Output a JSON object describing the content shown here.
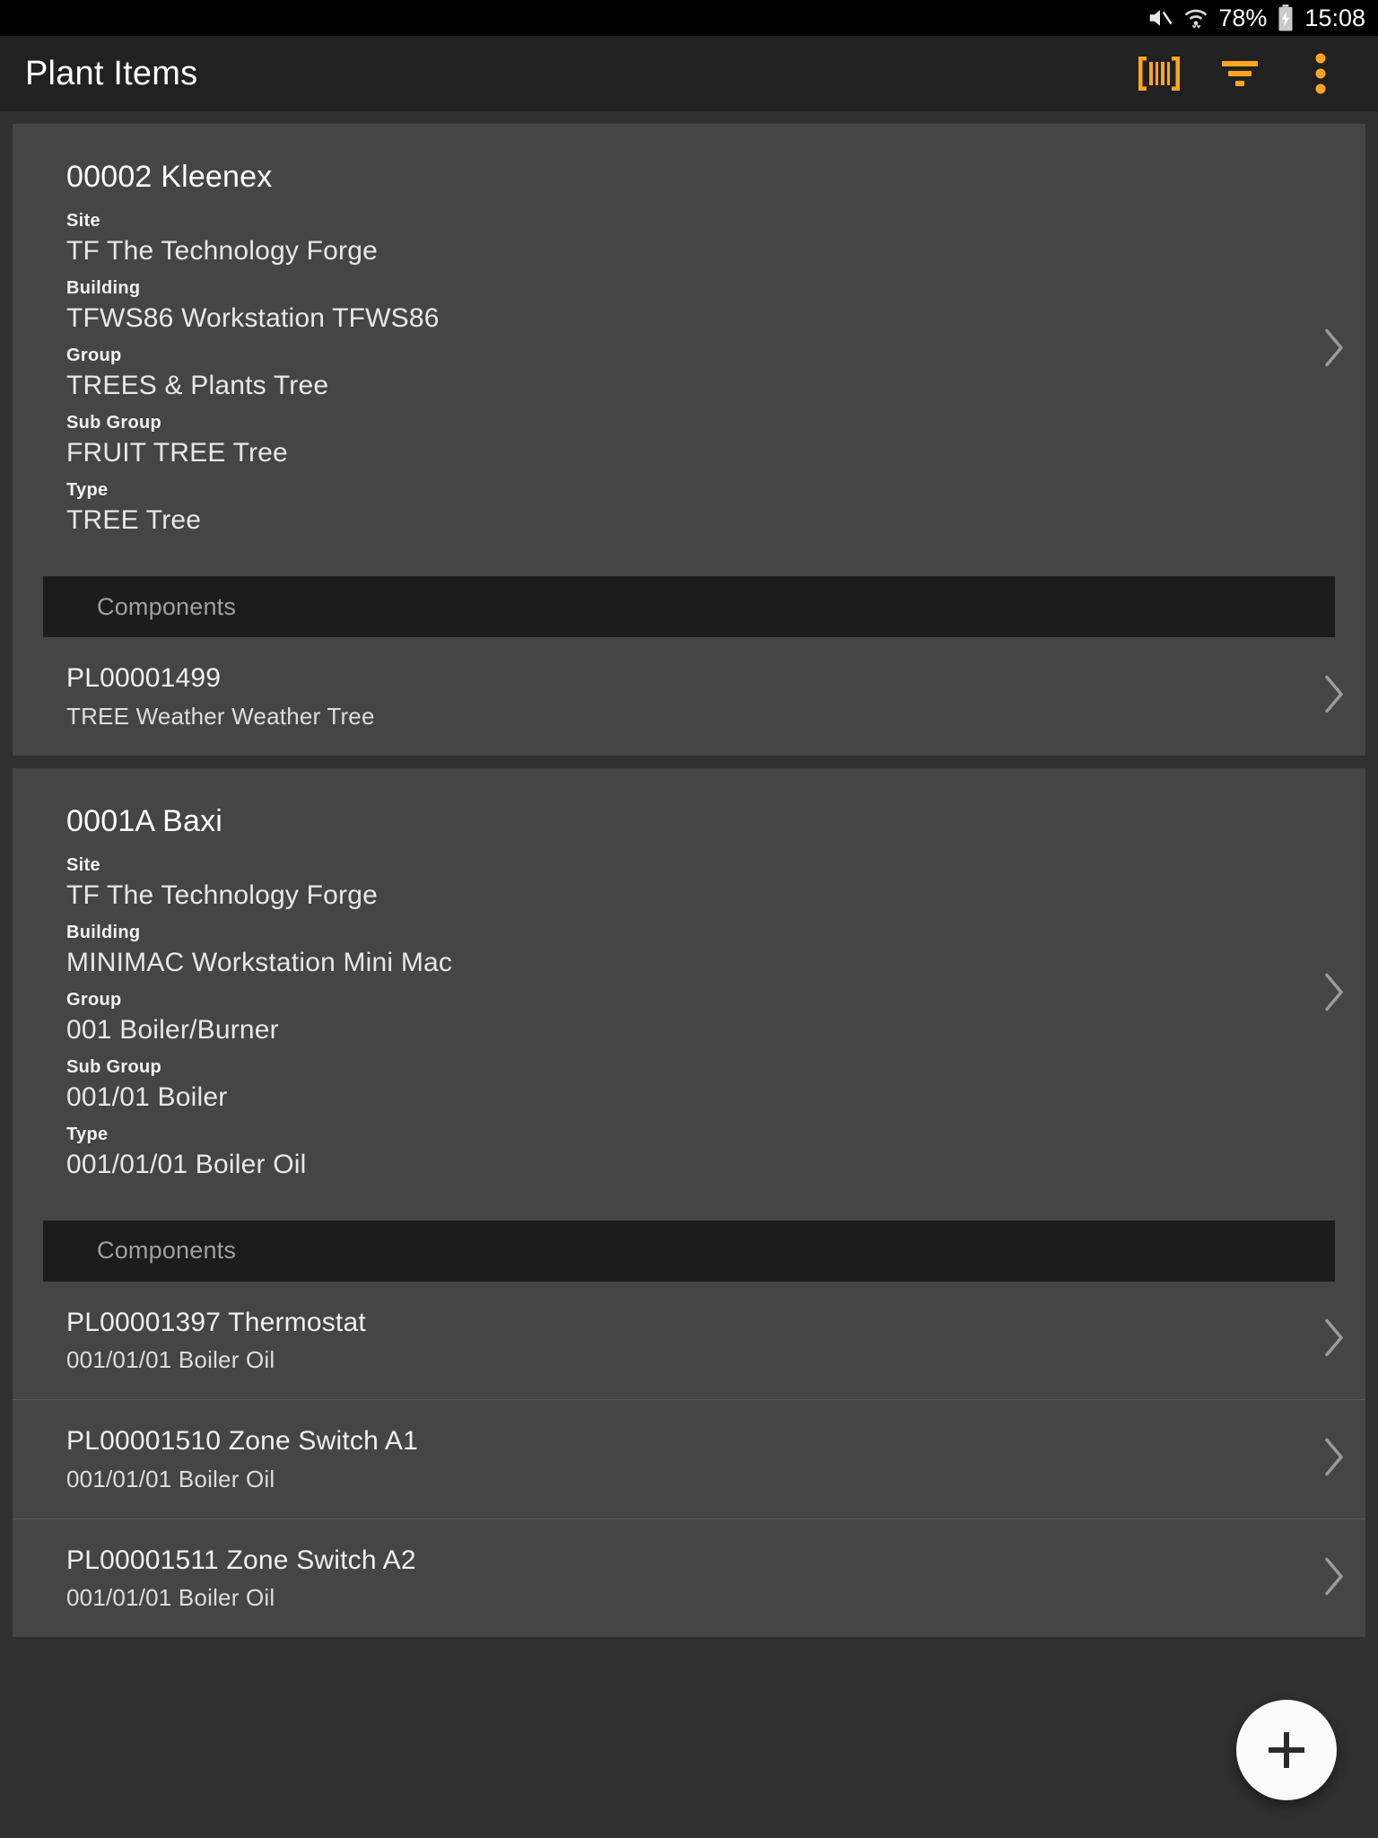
{
  "statusbar": {
    "battery_percent": "78%",
    "clock": "15:08",
    "icons": [
      "volume-mute-icon",
      "wifi-icon",
      "battery-charging-icon"
    ]
  },
  "appbar": {
    "title": "Plant Items",
    "accent_color": "#FFA51F",
    "actions": [
      {
        "name": "barcode-scan-button",
        "label": "Scan Barcode"
      },
      {
        "name": "filter-button",
        "label": "Filter"
      },
      {
        "name": "overflow-menu-button",
        "label": "More options"
      }
    ]
  },
  "labels": {
    "site": "Site",
    "building": "Building",
    "group": "Group",
    "sub_group": "Sub Group",
    "type": "Type",
    "components": "Components"
  },
  "cards": [
    {
      "title": "00002 Kleenex",
      "site": "TF The Technology Forge",
      "building": "TFWS86 Workstation TFWS86",
      "group": "TREES & Plants Tree",
      "sub_group": "FRUIT TREE Tree",
      "type": "TREE Tree",
      "components": [
        {
          "name": "PL00001499",
          "sub": "TREE Weather Weather Tree"
        }
      ]
    },
    {
      "title": "0001A Baxi",
      "site": "TF The Technology Forge",
      "building": "MINIMAC Workstation Mini Mac",
      "group": "001 Boiler/Burner",
      "sub_group": "001/01 Boiler",
      "type": "001/01/01 Boiler Oil",
      "components": [
        {
          "name": "PL00001397 Thermostat",
          "sub": "001/01/01 Boiler Oil"
        },
        {
          "name": "PL00001510 Zone Switch A1",
          "sub": "001/01/01 Boiler Oil"
        },
        {
          "name": "PL00001511 Zone Switch A2",
          "sub": "001/01/01 Boiler Oil"
        }
      ]
    }
  ],
  "fab": {
    "label": "+",
    "name": "add-plant-item-button"
  }
}
